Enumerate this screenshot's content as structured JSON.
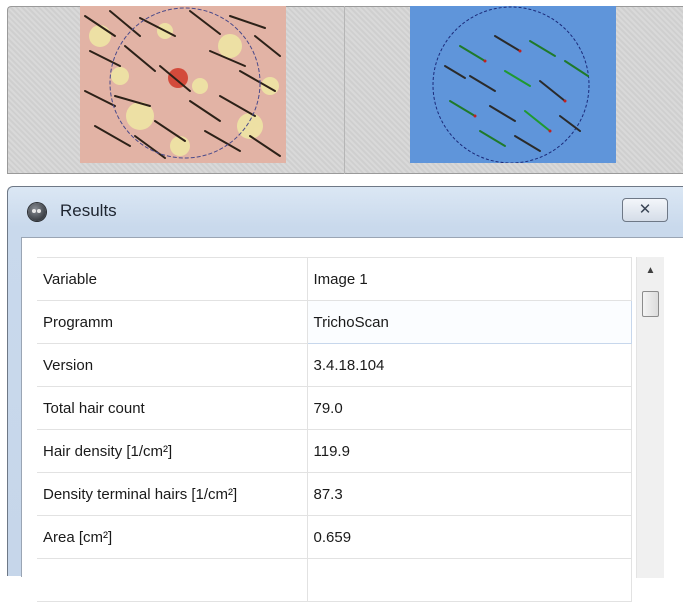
{
  "results": {
    "title": "Results",
    "close_glyph": "✕",
    "table": {
      "rows": [
        {
          "variable": "Variable",
          "value": "Image 1"
        },
        {
          "variable": "Programm",
          "value": "TrichoScan"
        },
        {
          "variable": "Version",
          "value": "3.4.18.104"
        },
        {
          "variable": "Total hair count",
          "value": "79.0"
        },
        {
          "variable": "Hair density [1/cm²]",
          "value": "119.9"
        },
        {
          "variable": "Density terminal hairs [1/cm²]",
          "value": "87.3"
        },
        {
          "variable": "Area [cm²]",
          "value": "0.659"
        },
        {
          "variable": "",
          "value": ""
        }
      ]
    },
    "scrollbar": {
      "up_glyph": "▲"
    }
  },
  "images": {
    "left": {
      "icon": "scalp-photo",
      "tint": "#e8b7a8"
    },
    "right": {
      "icon": "hair-segmentation",
      "background": "#5f95da"
    }
  },
  "colors": {
    "accent_selected": "#c7d7ec"
  }
}
